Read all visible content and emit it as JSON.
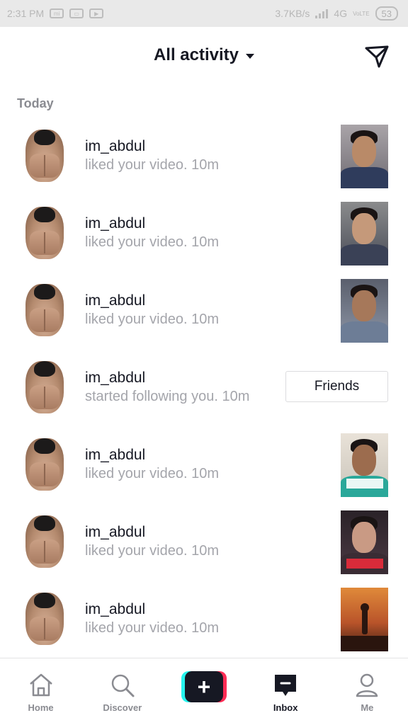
{
  "status_bar": {
    "time": "2:31 PM",
    "speed": "3.7KB/s",
    "network": "4G",
    "volte": "VoLTE",
    "battery": "53"
  },
  "header": {
    "title": "All activity",
    "send_icon": "send-icon"
  },
  "section": {
    "today_label": "Today"
  },
  "activities": [
    {
      "username": "im_abdul",
      "action": "liked your video.",
      "time": "10m",
      "thumb": "video-thumb"
    },
    {
      "username": "im_abdul",
      "action": "liked your video.",
      "time": "10m",
      "thumb": "video-thumb"
    },
    {
      "username": "im_abdul",
      "action": "liked your video.",
      "time": "10m",
      "thumb": "video-thumb"
    },
    {
      "username": "im_abdul",
      "action": "started following you.",
      "time": "10m",
      "button": "Friends"
    },
    {
      "username": "im_abdul",
      "action": "liked your video.",
      "time": "10m",
      "thumb": "video-thumb"
    },
    {
      "username": "im_abdul",
      "action": "liked your video.",
      "time": "10m",
      "thumb": "video-thumb"
    },
    {
      "username": "im_abdul",
      "action": "liked your video.",
      "time": "10m",
      "thumb": "video-thumb"
    }
  ],
  "nav": {
    "home": "Home",
    "discover": "Discover",
    "create": "+",
    "inbox": "Inbox",
    "me": "Me"
  },
  "colors": {
    "text_primary": "#161823",
    "text_secondary": "#a4a5ab",
    "accent_cyan": "#25f4ee",
    "accent_red": "#fe2c55"
  }
}
